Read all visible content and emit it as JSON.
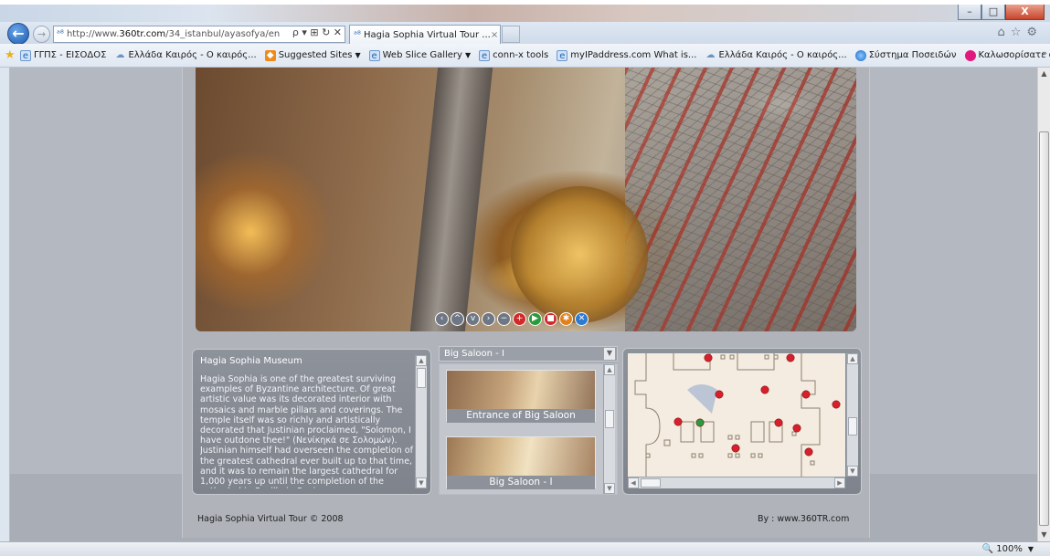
{
  "window": {
    "minimize_label": "–",
    "maximize_label": "□",
    "close_label": "X"
  },
  "nav": {
    "back_glyph": "←",
    "forward_glyph": "→",
    "address_prefix": "http://www.",
    "address_domain": "360tr.com",
    "address_path": "/34_istanbul/ayasofya/en",
    "address_tools": "ρ ▾ ⊞ ↻ ✕",
    "tab_title": "Hagia Sophia Virtual Tour ...",
    "tab_close": "×",
    "right_icons": "⌂☆⚙"
  },
  "favorites": {
    "items": [
      {
        "label": "ΓΓΠΣ - ΕΙΣΟΔΟΣ",
        "icon": "ie-page-icon",
        "caret": false
      },
      {
        "label": "Ελλάδα Καιρός - Ο καιρός...",
        "icon": "weather-cloud-icon",
        "caret": false
      },
      {
        "label": "Suggested Sites",
        "icon": "suggested-sites-icon",
        "caret": true
      },
      {
        "label": "Web Slice Gallery",
        "icon": "ie-page-icon",
        "caret": true
      },
      {
        "label": "conn-x tools",
        "icon": "ie-page-icon",
        "caret": false
      },
      {
        "label": "myIPaddress.com What is...",
        "icon": "ie-page-icon",
        "caret": false
      },
      {
        "label": "Ελλάδα Καιρός - Ο καιρός...",
        "icon": "weather-cloud-icon",
        "caret": false
      },
      {
        "label": "Σύστημα Ποσειδών",
        "icon": "globe-icon",
        "caret": false
      },
      {
        "label": "Καλωσορίσατε στο ecare...",
        "icon": "pink-circle-icon",
        "caret": false
      }
    ],
    "more": "»"
  },
  "tour": {
    "controls": [
      {
        "name": "pan-left-icon",
        "glyph": "‹",
        "color": "grey"
      },
      {
        "name": "pan-up-icon",
        "glyph": "^",
        "color": "grey"
      },
      {
        "name": "pan-down-icon",
        "glyph": "v",
        "color": "grey"
      },
      {
        "name": "pan-right-icon",
        "glyph": "›",
        "color": "grey"
      },
      {
        "name": "zoom-out-icon",
        "glyph": "−",
        "color": "grey"
      },
      {
        "name": "zoom-in-icon",
        "glyph": "+",
        "color": "red"
      },
      {
        "name": "play-icon",
        "glyph": "▶",
        "color": "green"
      },
      {
        "name": "stop-icon",
        "glyph": "■",
        "color": "red"
      },
      {
        "name": "hotspot-icon",
        "glyph": "✱",
        "color": "orange"
      },
      {
        "name": "fullscreen-icon",
        "glyph": "✕",
        "color": "blue"
      }
    ],
    "description": {
      "title": "Hagia Sophia Museum",
      "text": "Hagia Sophia is one of the greatest surviving examples of Byzantine architecture. Of great artistic value was its decorated interior with mosaics and marble pillars and coverings. The temple itself was so richly and artistically decorated that Justinian proclaimed, \"Solomon, I have outdone thee!\" (Νενίκηκά σε Σολομών). Justinian himself had overseen the completion of the greatest cathedral ever built up to that time, and it was to remain the largest cathedral for 1,000 years up until the completion of the cathedral in Seville in Spain."
    },
    "scene_select": "Big Saloon - I",
    "scenes": [
      {
        "label": "Entrance of Big Saloon"
      },
      {
        "label": "Big Saloon - I"
      }
    ],
    "footer_left": "Hagia Sophia Virtual Tour ©  2008",
    "footer_right": "By  :  www.360TR.com"
  },
  "statusbar": {
    "zoom": "100%"
  },
  "colors": {
    "page_bg": "#b4b8c0",
    "panel_bg": "#8a8f98",
    "map_hotspot": "#d8202c",
    "map_current": "#2b9a3c"
  }
}
